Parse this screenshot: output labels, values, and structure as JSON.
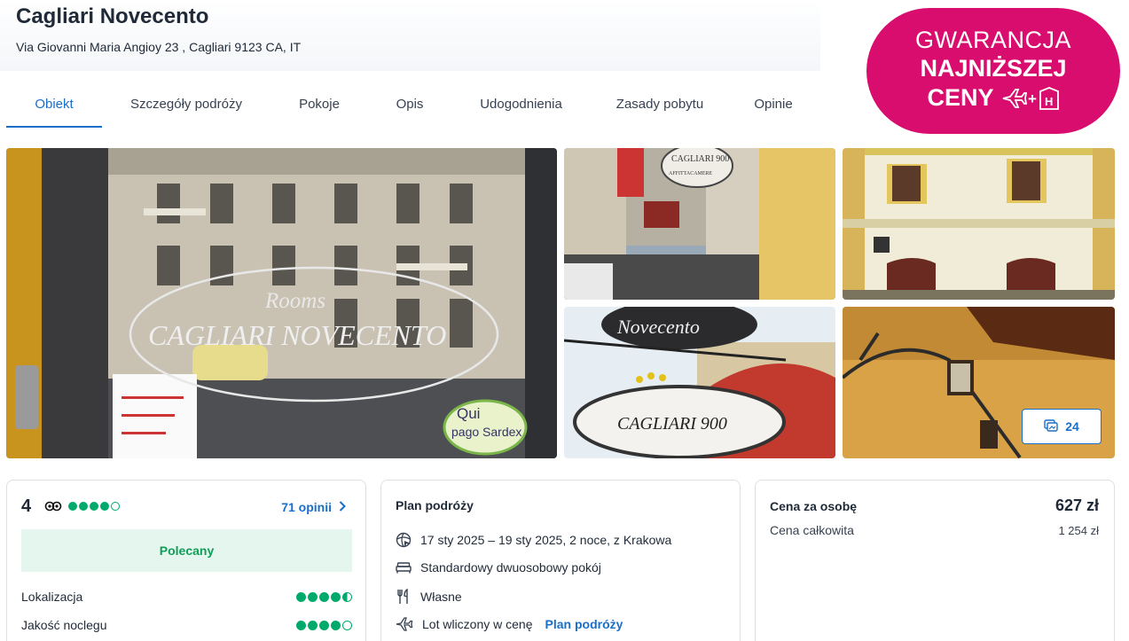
{
  "hotel": {
    "name": "Cagliari Novecento",
    "address": "Via Giovanni Maria Angioy 23 , Cagliari 9123 CA, IT"
  },
  "tabs": [
    {
      "label": "Obiekt",
      "active": true
    },
    {
      "label": "Szczegóły podróży",
      "active": false
    },
    {
      "label": "Pokoje",
      "active": false
    },
    {
      "label": "Opis",
      "active": false
    },
    {
      "label": "Udogodnienia",
      "active": false
    },
    {
      "label": "Zasady pobytu",
      "active": false
    },
    {
      "label": "Opinie",
      "active": false
    }
  ],
  "badge": {
    "line1": "GWARANCJA",
    "line2": "NAJNIŻSZEJ",
    "line3": "CENY",
    "icon": "flight-plus-hotel-icon",
    "color": "#d90d6e"
  },
  "gallery": {
    "photo_count": "24",
    "main_sign_line1": "Rooms",
    "main_sign_line2": "CAGLIARI NOVECENTO",
    "sticker_line1": "Qui",
    "sticker_line2": "pago Sardex",
    "sign1": "CAGLIARI 900",
    "sign1_sub": "AFFITTACAMERE",
    "sign3_top": "Novecento",
    "sign3_bottom": "CAGLIARI 900"
  },
  "rating": {
    "score": "4",
    "bubbles": 4,
    "reviews_label": "71 opinii",
    "recommended_label": "Polecany",
    "categories": [
      {
        "label": "Lokalizacja",
        "value": 4.5
      },
      {
        "label": "Jakość noclegu",
        "value": 4
      }
    ]
  },
  "plan": {
    "title": "Plan podróży",
    "dates": "17 sty 2025 – 19 sty 2025, 2 noce, z Krakowa",
    "room": "Standardowy dwuosobowy pokój",
    "board": "Własne",
    "flight": "Lot wliczony w cenę",
    "flight_link": "Plan podróży"
  },
  "price": {
    "per_person_label": "Cena za osobę",
    "per_person_value": "627 zł",
    "total_label": "Cena całkowita",
    "total_value": "1 254 zł"
  },
  "colors": {
    "accent": "#1a6fc9",
    "rating_green": "#00aa6c",
    "recommended_bg": "#e5f6ee"
  }
}
